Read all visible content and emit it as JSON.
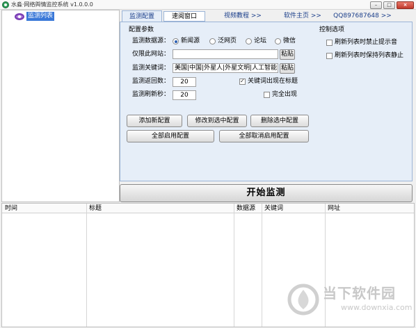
{
  "window": {
    "title": "水淼·网络舆情监控系统 v1.0.0.0",
    "minimize": "–",
    "maximize": "□",
    "close": "×"
  },
  "tree": {
    "root_label": "监测列表"
  },
  "tabs": {
    "monitor": "监测配置",
    "browse": "速阅窗口",
    "video": "视频教程 >>",
    "home": "软件主页 >>",
    "qq": "QQ897687648 >>"
  },
  "config": {
    "group_title": "配置参数",
    "source_label": "监测数据源：",
    "sources": [
      {
        "label": "新闻源",
        "selected": true
      },
      {
        "label": "泛网页",
        "selected": false
      },
      {
        "label": "论坛",
        "selected": false
      },
      {
        "label": "微信",
        "selected": false
      }
    ],
    "site_label": "仅限此网站：",
    "site_value": "",
    "paste_label": "粘贴",
    "keywords_label": "监测关键词：",
    "keywords_value": "美国|中国|外星人|外星文明|人工智能",
    "return_label": "监测返回数：",
    "return_value": "20",
    "refresh_label": "监测刷新秒：",
    "refresh_value": "20",
    "title_match_label": "关键词出现在标题",
    "title_match_checked": true,
    "full_match_label": "完全出现",
    "full_match_checked": false
  },
  "control": {
    "group_title": "控制选项",
    "mute_label": "刷新列表时禁止提示音",
    "mute_checked": false,
    "still_label": "刷新列表时保持列表静止",
    "still_checked": false
  },
  "buttons": {
    "add": "添加新配置",
    "modify": "修改到选中配置",
    "delete": "删除选中配置",
    "enable_all": "全部启用配置",
    "disable_all": "全部取消启用配置",
    "start": "开始监测"
  },
  "grid": {
    "columns": [
      "时间",
      "标题",
      "数据源",
      "关键词",
      "网址"
    ]
  },
  "watermark": {
    "title": "当下软件园",
    "url": "www.downxia.com"
  }
}
